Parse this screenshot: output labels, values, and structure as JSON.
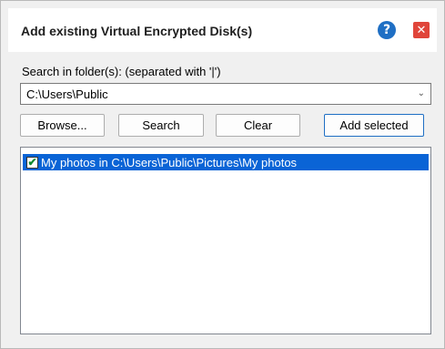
{
  "dialog": {
    "title": "Add existing Virtual Encrypted Disk(s)",
    "help_icon": "question-mark-icon",
    "close_icon": "close-x-icon"
  },
  "search": {
    "label": "Search in folder(s): (separated with '|')",
    "folder_value": "C:\\Users\\Public"
  },
  "buttons": {
    "browse": "Browse...",
    "search": "Search",
    "clear": "Clear",
    "add_selected": "Add selected"
  },
  "results": [
    {
      "checked": true,
      "label": "My photos in C:\\Users\\Public\\Pictures\\My photos",
      "selected": true
    }
  ],
  "colors": {
    "help_button": "#1f6fc4",
    "close_button": "#e0453a",
    "selection": "#0a64d6",
    "check": "#0f8a2e"
  }
}
